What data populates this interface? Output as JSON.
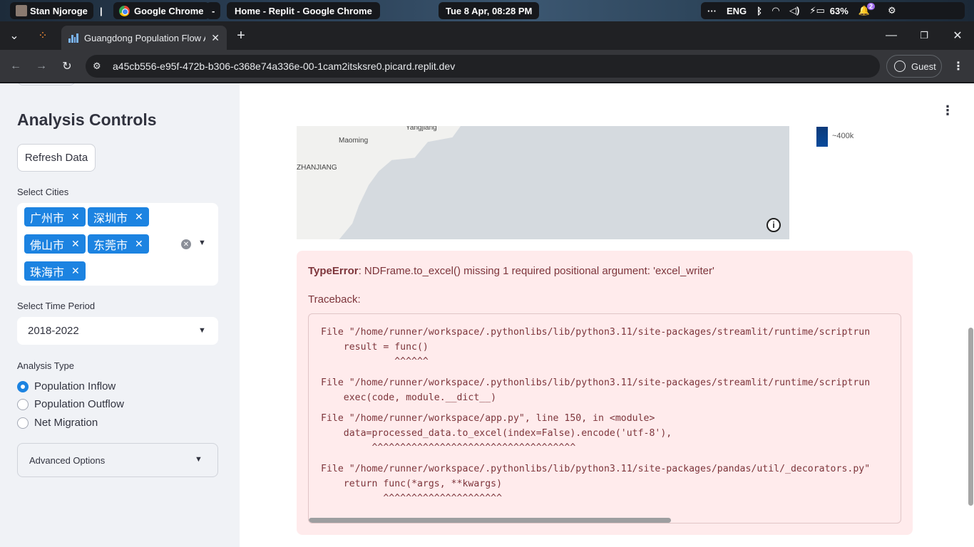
{
  "os": {
    "user": "Stan Njoroge",
    "separator": "|",
    "app": "Google Chrome",
    "dash": "-",
    "window_title": "Home - Replit - Google Chrome",
    "datetime": "Tue 8 Apr, 08:28 PM",
    "more": "···",
    "lang": "ENG",
    "battery": "63%",
    "notif_count": "2"
  },
  "browser": {
    "tab_title": "Guangdong Population Flow An",
    "new_tab": "+",
    "url": "a45cb556-e95f-472b-b306-c368e74a336e-00-1cam2itsksre0.picard.replit.dev",
    "guest": "Guest"
  },
  "sidebar": {
    "title": "Analysis Controls",
    "refresh_label": "Refresh Data",
    "cities_label": "Select Cities",
    "cities": [
      "广州市",
      "深圳市",
      "佛山市",
      "东莞市",
      "珠海市"
    ],
    "time_label": "Select Time Period",
    "time_value": "2018-2022",
    "analysis_label": "Analysis Type",
    "analysis_options": [
      "Population Inflow",
      "Population Outflow",
      "Net Migration"
    ],
    "analysis_selected": 0,
    "advanced_label": "Advanced Options"
  },
  "map": {
    "cities": [
      "Yangjiang",
      "Maoming",
      "ZHANJIANG"
    ],
    "legend_label": "~400k"
  },
  "error": {
    "type": "TypeError",
    "message": ": NDFrame.to_excel() missing 1 required positional argument: 'excel_writer'",
    "traceback_label": "Traceback:",
    "lines": [
      "File \"/home/runner/workspace/.pythonlibs/lib/python3.11/site-packages/streamlit/runtime/scriptrun",
      "    result = func()",
      "             ^^^^^^",
      "File \"/home/runner/workspace/.pythonlibs/lib/python3.11/site-packages/streamlit/runtime/scriptrun",
      "    exec(code, module.__dict__)",
      "File \"/home/runner/workspace/app.py\", line 150, in <module>",
      "    data=processed_data.to_excel(index=False).encode('utf-8'),",
      "         ^^^^^^^^^^^^^^^^^^^^^^^^^^^^^^^^^^^^",
      "File \"/home/runner/workspace/.pythonlibs/lib/python3.11/site-packages/pandas/util/_decorators.py\"",
      "    return func(*args, **kwargs)",
      "           ^^^^^^^^^^^^^^^^^^^^^"
    ]
  }
}
